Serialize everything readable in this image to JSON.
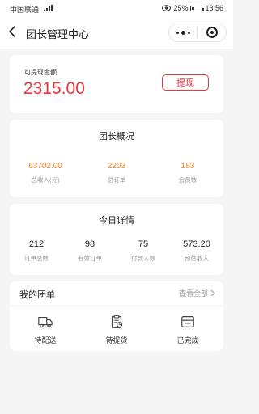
{
  "status_bar": {
    "carrier": "中国联通",
    "battery": "25%",
    "time": "13:56"
  },
  "nav": {
    "title": "团长管理中心"
  },
  "balance": {
    "label": "可提现金额",
    "amount": "2315.00",
    "withdraw_label": "提现"
  },
  "overview": {
    "title": "团长概况",
    "stats": [
      {
        "value": "63702.00",
        "label": "总收入(元)"
      },
      {
        "value": "2203",
        "label": "总订单"
      },
      {
        "value": "183",
        "label": "会员数"
      }
    ]
  },
  "today": {
    "title": "今日详情",
    "stats": [
      {
        "value": "212",
        "label": "订单总数"
      },
      {
        "value": "98",
        "label": "有效订单"
      },
      {
        "value": "75",
        "label": "付款人数"
      },
      {
        "value": "573.20",
        "label": "预估收入"
      }
    ]
  },
  "orders": {
    "title": "我的团单",
    "view_all": "查看全部",
    "items": [
      {
        "label": "待配送",
        "icon": "truck-icon"
      },
      {
        "label": "待提货",
        "icon": "clipboard-clock-icon"
      },
      {
        "label": "已完成",
        "icon": "completed-box-icon"
      }
    ]
  },
  "colors": {
    "accent_red": "#e5383b",
    "accent_orange": "#f0801e"
  }
}
